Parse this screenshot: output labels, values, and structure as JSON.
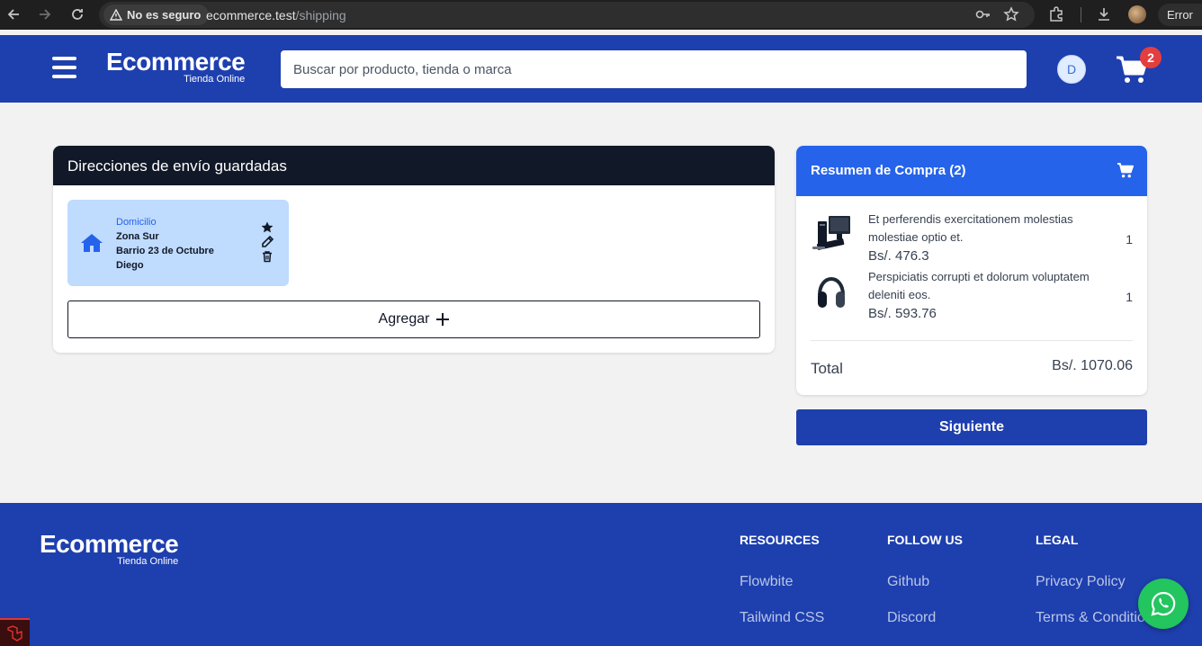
{
  "browser": {
    "security_label": "No es seguro",
    "url_host": "ecommerce.test",
    "url_path": "/shipping",
    "error_label": "Error"
  },
  "header": {
    "logo_title": "Ecommerce",
    "logo_subtitle": "Tienda Online",
    "search_placeholder": "Buscar por producto, tienda o marca",
    "user_initial": "D",
    "cart_count": "2"
  },
  "addresses": {
    "title": "Direcciones de envío guardadas",
    "items": [
      {
        "type": "Domicilio",
        "zone": "Zona Sur",
        "street": "Barrio 23 de Octubre",
        "name": "Diego"
      }
    ],
    "add_label": "Agregar"
  },
  "summary": {
    "title": "Resumen de Compra (2)",
    "products": [
      {
        "name": "Et perferendis exercitationem molestias molestiae optio et.",
        "price": "Bs/. 476.3",
        "qty": "1",
        "image": "computer-image"
      },
      {
        "name": "Perspiciatis corrupti et dolorum voluptatem deleniti eos.",
        "price": "Bs/. 593.76",
        "qty": "1",
        "image": "headphones-image"
      }
    ],
    "total_label": "Total",
    "total_value": "Bs/. 1070.06",
    "next_label": "Siguiente"
  },
  "footer": {
    "logo_title": "Ecommerce",
    "logo_subtitle": "Tienda Online",
    "columns": [
      {
        "heading": "RESOURCES",
        "links": [
          "Flowbite",
          "Tailwind CSS"
        ]
      },
      {
        "heading": "FOLLOW US",
        "links": [
          "Github",
          "Discord"
        ]
      },
      {
        "heading": "LEGAL",
        "links": [
          "Privacy Policy",
          "Terms & Conditions"
        ]
      }
    ]
  },
  "colors": {
    "brand_blue": "#1e3fae",
    "accent_blue": "#2563eb",
    "dark_header": "#111827",
    "address_bg": "#bfdbfe",
    "whatsapp_green": "#22c55e",
    "badge_red": "#e53e3e"
  },
  "icons": [
    "back-icon",
    "forward-icon",
    "reload-icon",
    "warning-icon",
    "key-icon",
    "star-icon",
    "extensions-icon",
    "download-icon",
    "menu-icon",
    "cart-icon",
    "home-icon",
    "star-icon",
    "pencil-icon",
    "trash-icon",
    "plus-icon",
    "whatsapp-icon",
    "laravel-icon"
  ]
}
